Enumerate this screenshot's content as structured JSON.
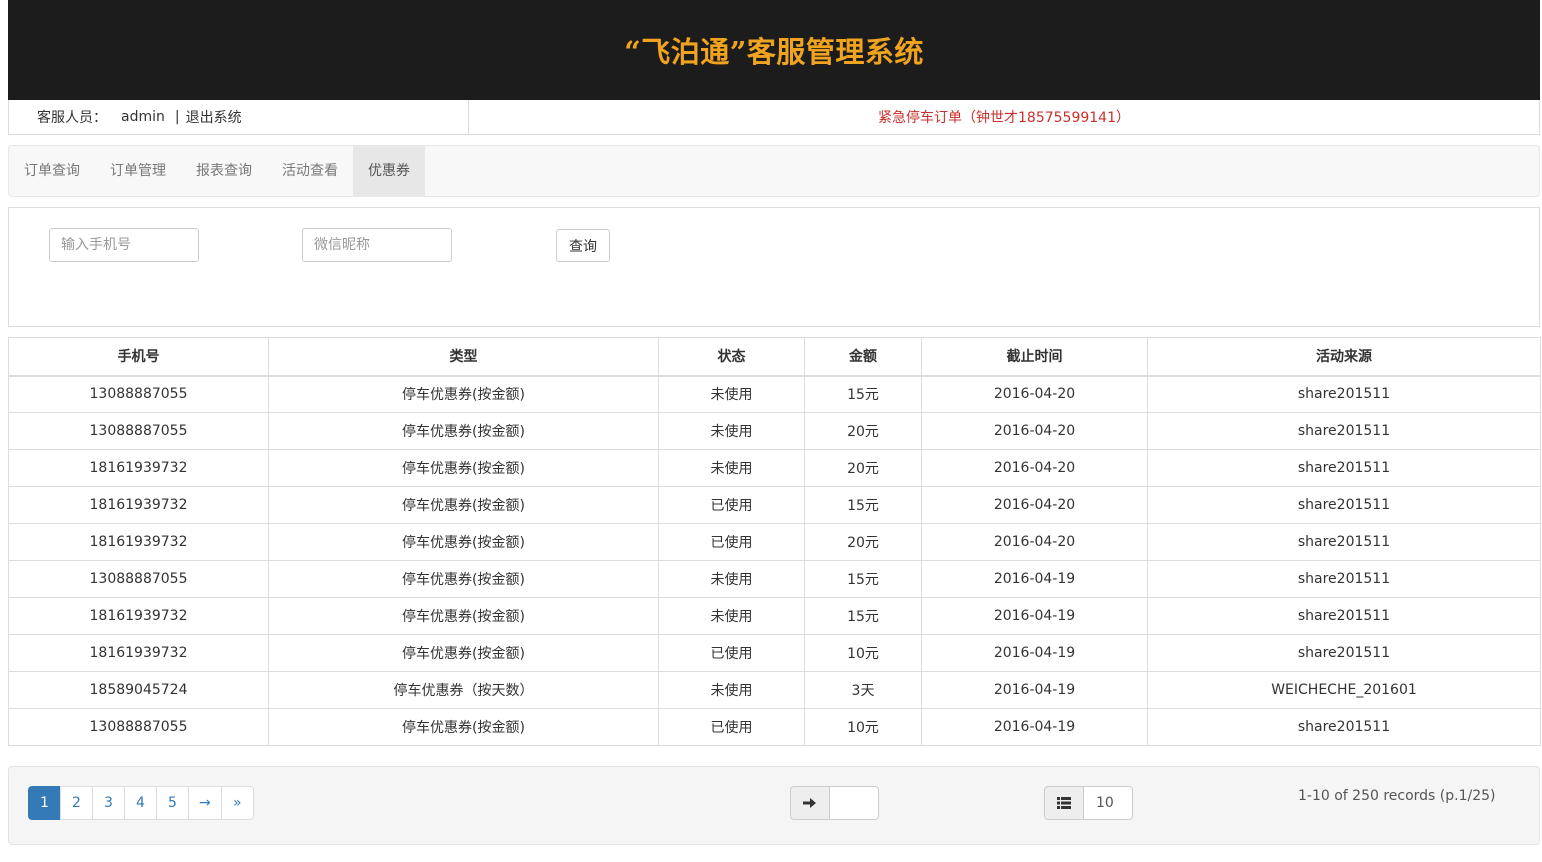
{
  "header": {
    "title": "“飞泊通”客服管理系统"
  },
  "infobar": {
    "staff_label": "客服人员：",
    "staff_name": "admin",
    "separator": "|",
    "logout": "退出系统",
    "emergency": "紧急停车订单（钟世才18575599141）"
  },
  "nav": {
    "items": [
      {
        "label": "订单查询"
      },
      {
        "label": "订单管理"
      },
      {
        "label": "报表查询"
      },
      {
        "label": "活动查看"
      },
      {
        "label": "优惠券"
      }
    ],
    "active_index": 4
  },
  "search": {
    "phone_placeholder": "输入手机号",
    "nickname_placeholder": "微信昵称",
    "button": "查询"
  },
  "table": {
    "headers": [
      "手机号",
      "类型",
      "状态",
      "金额",
      "截止时间",
      "活动来源"
    ],
    "rows": [
      [
        "13088887055",
        "停车优惠券(按金额)",
        "未使用",
        "15元",
        "2016-04-20",
        "share201511"
      ],
      [
        "13088887055",
        "停车优惠券(按金额)",
        "未使用",
        "20元",
        "2016-04-20",
        "share201511"
      ],
      [
        "18161939732",
        "停车优惠券(按金额)",
        "未使用",
        "20元",
        "2016-04-20",
        "share201511"
      ],
      [
        "18161939732",
        "停车优惠券(按金额)",
        "已使用",
        "15元",
        "2016-04-20",
        "share201511"
      ],
      [
        "18161939732",
        "停车优惠券(按金额)",
        "已使用",
        "20元",
        "2016-04-20",
        "share201511"
      ],
      [
        "13088887055",
        "停车优惠券(按金额)",
        "未使用",
        "15元",
        "2016-04-19",
        "share201511"
      ],
      [
        "18161939732",
        "停车优惠券(按金额)",
        "未使用",
        "15元",
        "2016-04-19",
        "share201511"
      ],
      [
        "18161939732",
        "停车优惠券(按金额)",
        "已使用",
        "10元",
        "2016-04-19",
        "share201511"
      ],
      [
        "18589045724",
        "停车优惠券（按天数）",
        "未使用",
        "3天",
        "2016-04-19",
        "WEICHECHE_201601"
      ],
      [
        "13088887055",
        "停车优惠券(按金额)",
        "已使用",
        "10元",
        "2016-04-19",
        "share201511"
      ]
    ]
  },
  "pagination": {
    "pages": [
      "1",
      "2",
      "3",
      "4",
      "5",
      "→",
      "»"
    ],
    "active": "1",
    "goto_value": "",
    "page_size": "10",
    "records_text": "1-10 of 250 records (p.1/25)"
  },
  "icons": {
    "goto": "arrow-right-icon",
    "page_size": "list-icon"
  },
  "colors": {
    "header_bg": "#1c1c1c",
    "title": "#f0a31f",
    "emergency": "#c9302c",
    "active_page": "#337ab7"
  }
}
